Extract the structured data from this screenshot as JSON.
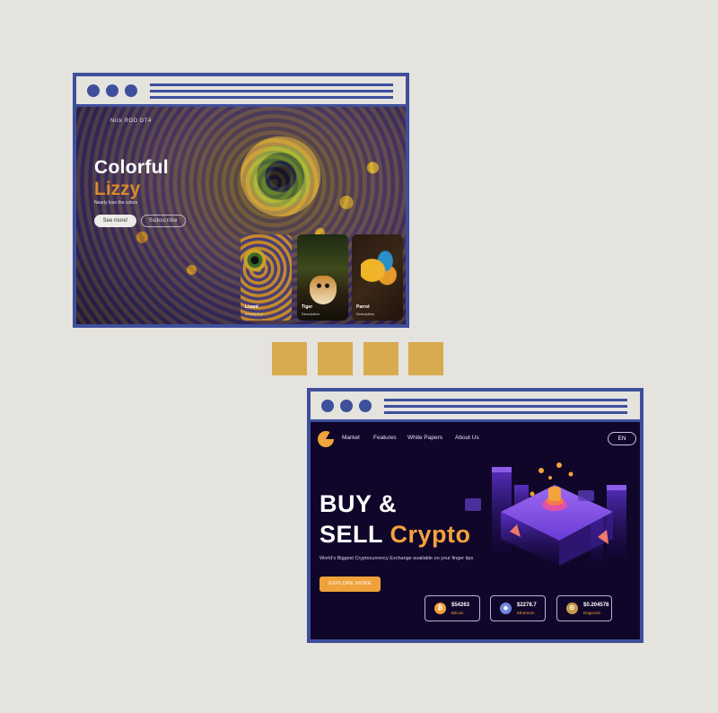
{
  "lizard_page": {
    "nav": "Nick ROD DT4",
    "title": "Colorful",
    "subtitle": "Lizzy",
    "tagline": "Nearly lose the colors",
    "see_more_label": "See more!",
    "subscribe_label": "Subscribe",
    "cards": [
      {
        "name": "Lizard",
        "description": "Description"
      },
      {
        "name": "Tiger",
        "description": "Description"
      },
      {
        "name": "Parrot",
        "description": "Description"
      }
    ]
  },
  "crypto_page": {
    "menu": [
      "Market",
      "Features",
      "White Papers",
      "About Us"
    ],
    "language": "EN",
    "hero_line1": "BUY &",
    "hero_line2_prefix": "SELL",
    "hero_line2_accent": "Crypto",
    "tagline": "World's Biggest Cryptocurrency Exchange available on your finger tips",
    "explore_label": "EXPLORE MORE",
    "coins": [
      {
        "price": "$54263",
        "name": "Bitcoin",
        "symbol": "₿",
        "icon": "bitcoin-icon"
      },
      {
        "price": "$2278.7",
        "name": "Ethereum",
        "symbol": "◆",
        "icon": "ethereum-icon"
      },
      {
        "price": "$0.204578",
        "name": "Dogecoin",
        "symbol": "Ð",
        "icon": "dogecoin-icon"
      }
    ]
  },
  "colors": {
    "frame": "#3e4f9c",
    "background": "#e4e3de",
    "square": "#d9ab4f",
    "crypto_bg": "#10062a",
    "accent_orange": "#f0a23a",
    "lizzy_orange": "#d98a2b"
  }
}
